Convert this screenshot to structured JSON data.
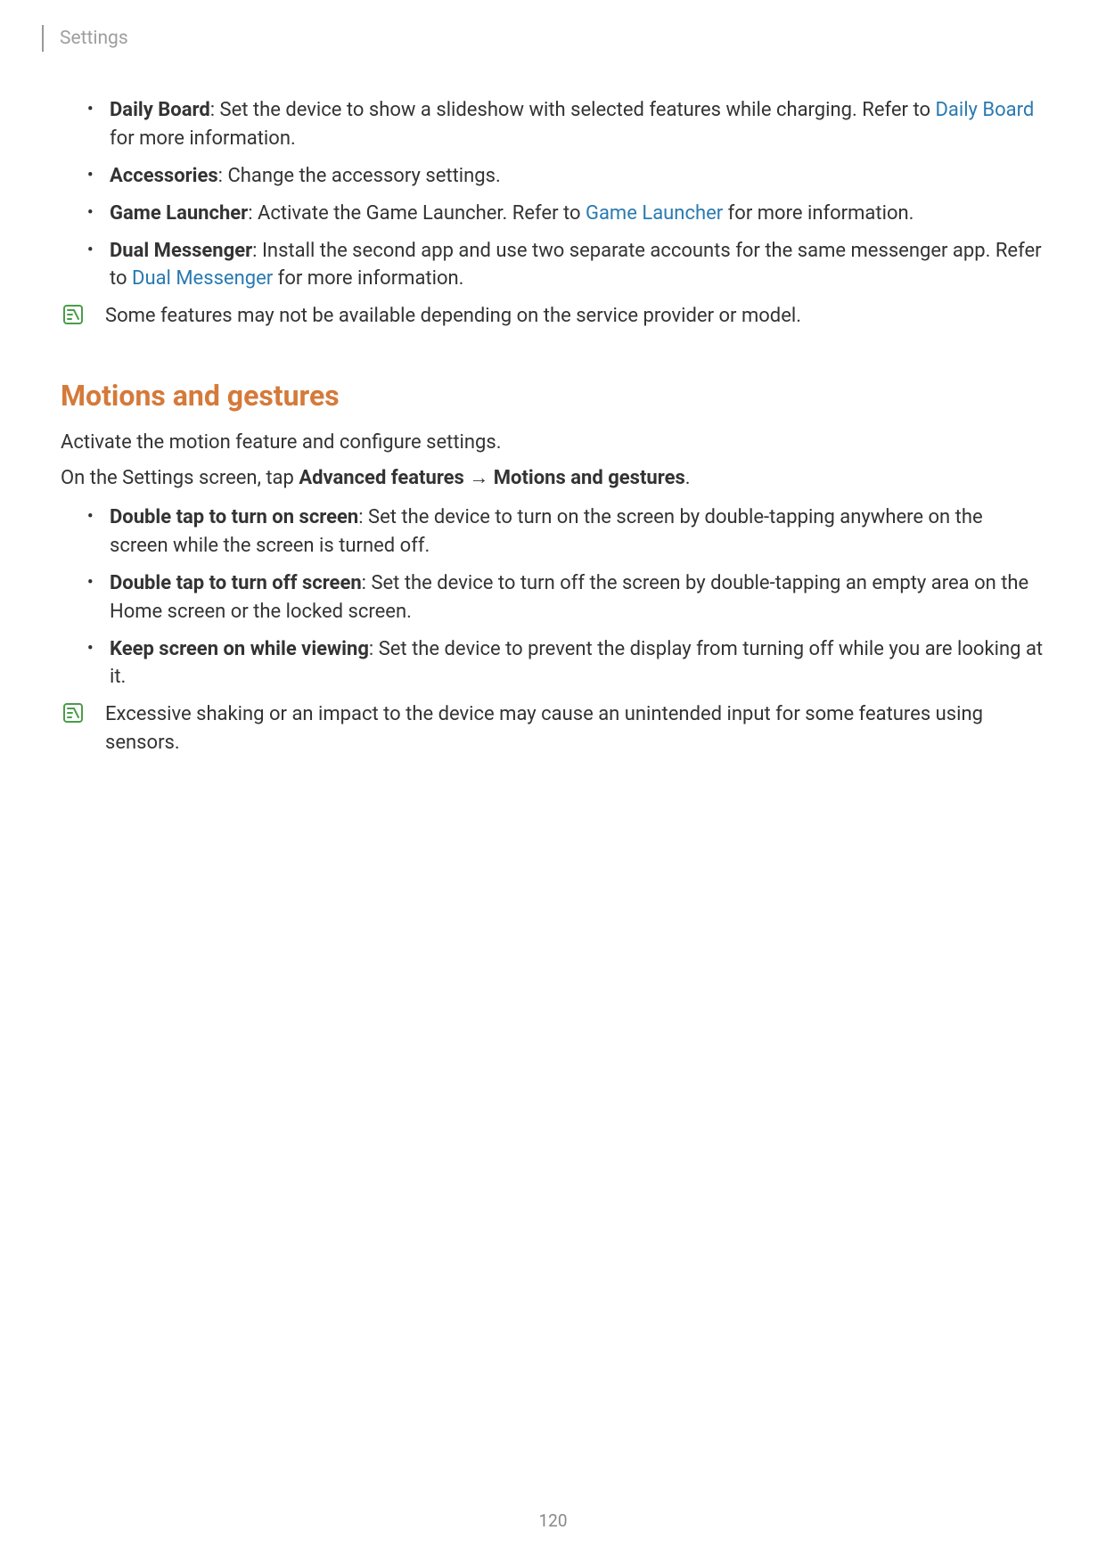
{
  "header": {
    "title": "Settings"
  },
  "list1": {
    "items": [
      {
        "bold": "Daily Board",
        "text": ": Set the device to show a slideshow with selected features while charging. Refer to ",
        "link": "Daily Board",
        "after_link": " for more information."
      },
      {
        "bold": "Accessories",
        "text": ": Change the accessory settings."
      },
      {
        "bold": "Game Launcher",
        "text": ": Activate the Game Launcher. Refer to ",
        "link": "Game Launcher",
        "after_link": " for more information."
      },
      {
        "bold": "Dual Messenger",
        "text": ": Install the second app and use two separate accounts for the same messenger app. Refer to ",
        "link": "Dual Messenger",
        "after_link": " for more information."
      }
    ]
  },
  "note1": "Some features may not be available depending on the service provider or model.",
  "section": {
    "heading": "Motions and gestures",
    "intro": "Activate the motion feature and configure settings.",
    "path_prefix": "On the Settings screen, tap ",
    "path_bold1": "Advanced features",
    "arrow": " → ",
    "path_bold2": "Motions and gestures",
    "path_suffix": "."
  },
  "list2": {
    "items": [
      {
        "bold": "Double tap to turn on screen",
        "text": ": Set the device to turn on the screen by double-tapping anywhere on the screen while the screen is turned off."
      },
      {
        "bold": "Double tap to turn off screen",
        "text": ": Set the device to turn off the screen by double-tapping an empty area on the Home screen or the locked screen."
      },
      {
        "bold": "Keep screen on while viewing",
        "text": ": Set the device to prevent the display from turning off while you are looking at it."
      }
    ]
  },
  "note2": "Excessive shaking or an impact to the device may cause an unintended input for some features using sensors.",
  "page_number": "120"
}
